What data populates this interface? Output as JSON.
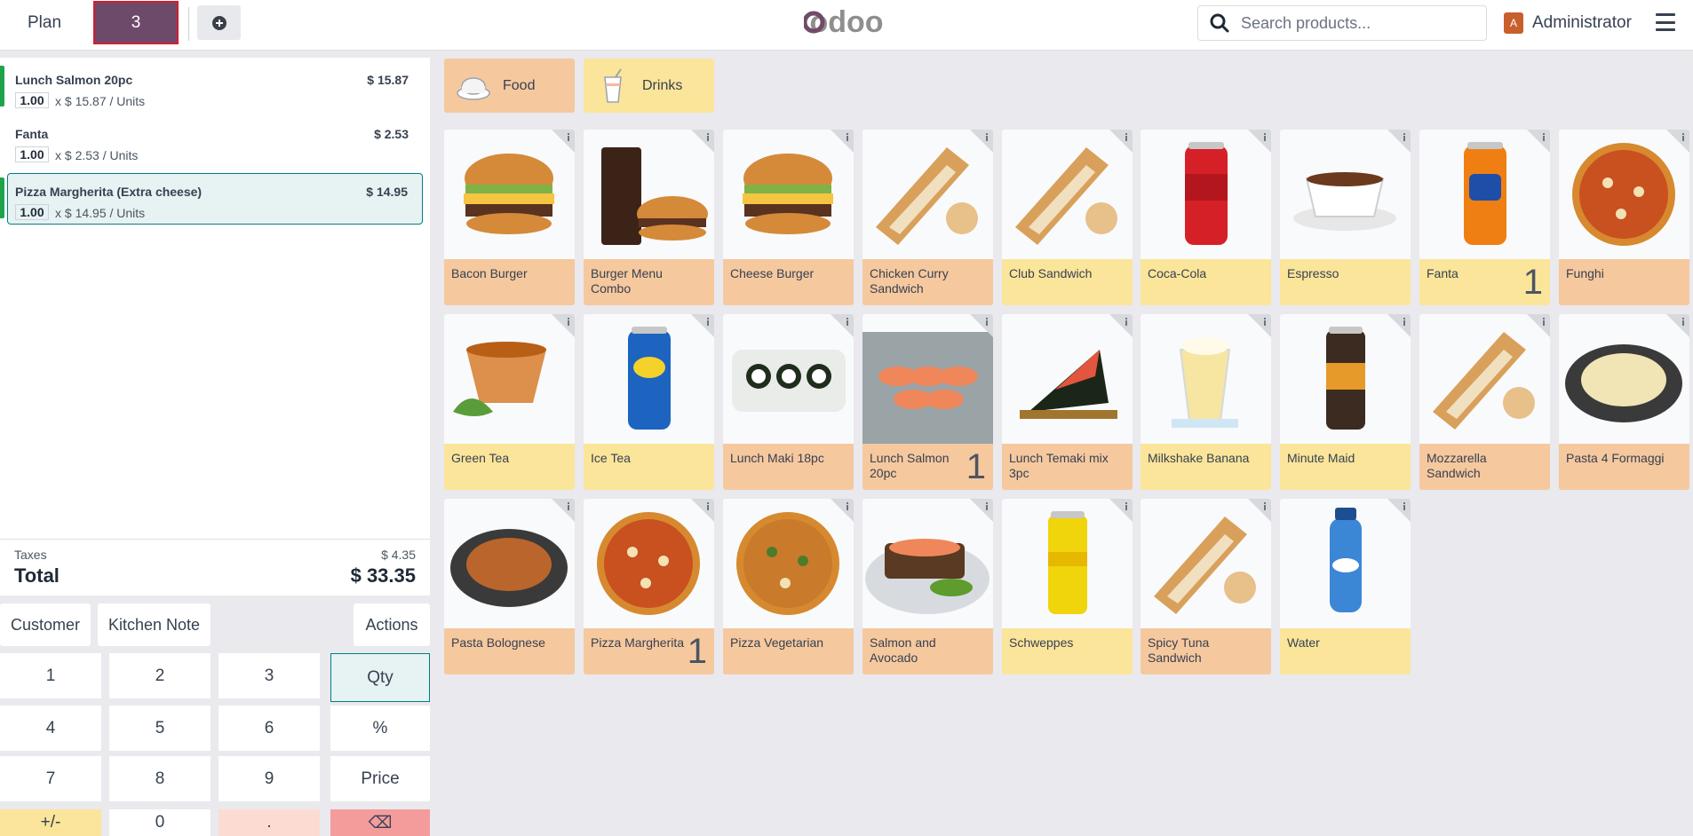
{
  "topbar": {
    "plan_label": "Plan",
    "table_number": "3",
    "logo_text": "odoo",
    "search_placeholder": "Search products...",
    "user_initial": "A",
    "user_name": "Administrator"
  },
  "order": {
    "lines": [
      {
        "name": "Lunch Salmon 20pc",
        "price": "$ 15.87",
        "qty": "1.00",
        "unit_text": "x $ 15.87 / Units",
        "selected": false
      },
      {
        "name": "Fanta",
        "price": "$ 2.53",
        "qty": "1.00",
        "unit_text": "x $ 2.53 / Units",
        "selected": false
      },
      {
        "name": "Pizza Margherita (Extra cheese)",
        "price": "$ 14.95",
        "qty": "1.00",
        "unit_text": "x $ 14.95 / Units",
        "selected": true
      }
    ],
    "taxes_label": "Taxes",
    "taxes_value": "$ 4.35",
    "total_label": "Total",
    "total_value": "$ 33.35"
  },
  "actions": {
    "customer": "Customer",
    "kitchen_note": "Kitchen Note",
    "actions": "Actions"
  },
  "numpad": {
    "k1": "1",
    "k2": "2",
    "k3": "3",
    "qty": "Qty",
    "k4": "4",
    "k5": "5",
    "k6": "6",
    "percent": "%",
    "k7": "7",
    "k8": "8",
    "k9": "9",
    "price": "Price",
    "plusminus": "+/-",
    "k0": "0",
    "dot": ".",
    "backspace": "⌫"
  },
  "categories": [
    {
      "label": "Food",
      "icon": "food-bowl-icon"
    },
    {
      "label": "Drinks",
      "icon": "drink-cup-icon"
    }
  ],
  "products": [
    {
      "name": "Bacon Burger",
      "type": "food",
      "qty": "",
      "icon": "burger"
    },
    {
      "name": "Burger Menu Combo",
      "type": "food",
      "qty": "",
      "icon": "combo"
    },
    {
      "name": "Cheese Burger",
      "type": "food",
      "qty": "",
      "icon": "burger"
    },
    {
      "name": "Chicken Curry Sandwich",
      "type": "food",
      "qty": "",
      "icon": "sandwich"
    },
    {
      "name": "Club Sandwich",
      "type": "drink",
      "qty": "",
      "icon": "sandwich"
    },
    {
      "name": "Coca-Cola",
      "type": "drink",
      "qty": "",
      "icon": "can-red"
    },
    {
      "name": "Espresso",
      "type": "drink",
      "qty": "",
      "icon": "coffee"
    },
    {
      "name": "Fanta",
      "type": "drink",
      "qty": "1",
      "icon": "can-orange"
    },
    {
      "name": "Funghi",
      "type": "food",
      "qty": "",
      "icon": "pizza"
    },
    {
      "name": "Green Tea",
      "type": "drink",
      "qty": "",
      "icon": "tea"
    },
    {
      "name": "Ice Tea",
      "type": "drink",
      "qty": "",
      "icon": "can-blue"
    },
    {
      "name": "Lunch Maki 18pc",
      "type": "food",
      "qty": "",
      "icon": "maki"
    },
    {
      "name": "Lunch Salmon 20pc",
      "type": "food",
      "qty": "1",
      "icon": "salmon"
    },
    {
      "name": "Lunch Temaki mix 3pc",
      "type": "food",
      "qty": "",
      "icon": "temaki"
    },
    {
      "name": "Milkshake Banana",
      "type": "drink",
      "qty": "",
      "icon": "milkshake"
    },
    {
      "name": "Minute Maid",
      "type": "drink",
      "qty": "",
      "icon": "can-dark"
    },
    {
      "name": "Mozzarella Sandwich",
      "type": "food",
      "qty": "",
      "icon": "sandwich"
    },
    {
      "name": "Pasta 4 Formaggi",
      "type": "food",
      "qty": "",
      "icon": "pasta-white"
    },
    {
      "name": "Pasta Bolognese",
      "type": "food",
      "qty": "",
      "icon": "pasta-red"
    },
    {
      "name": "Pizza Margherita",
      "type": "food",
      "qty": "1",
      "icon": "pizza"
    },
    {
      "name": "Pizza Vegetarian",
      "type": "food",
      "qty": "",
      "icon": "pizza-veg"
    },
    {
      "name": "Salmon and Avocado",
      "type": "food",
      "qty": "",
      "icon": "salmon-toast"
    },
    {
      "name": "Schweppes",
      "type": "drink",
      "qty": "",
      "icon": "can-yellow"
    },
    {
      "name": "Spicy Tuna Sandwich",
      "type": "food",
      "qty": "",
      "icon": "sandwich"
    },
    {
      "name": "Water",
      "type": "drink",
      "qty": "",
      "icon": "water-bottle"
    }
  ]
}
